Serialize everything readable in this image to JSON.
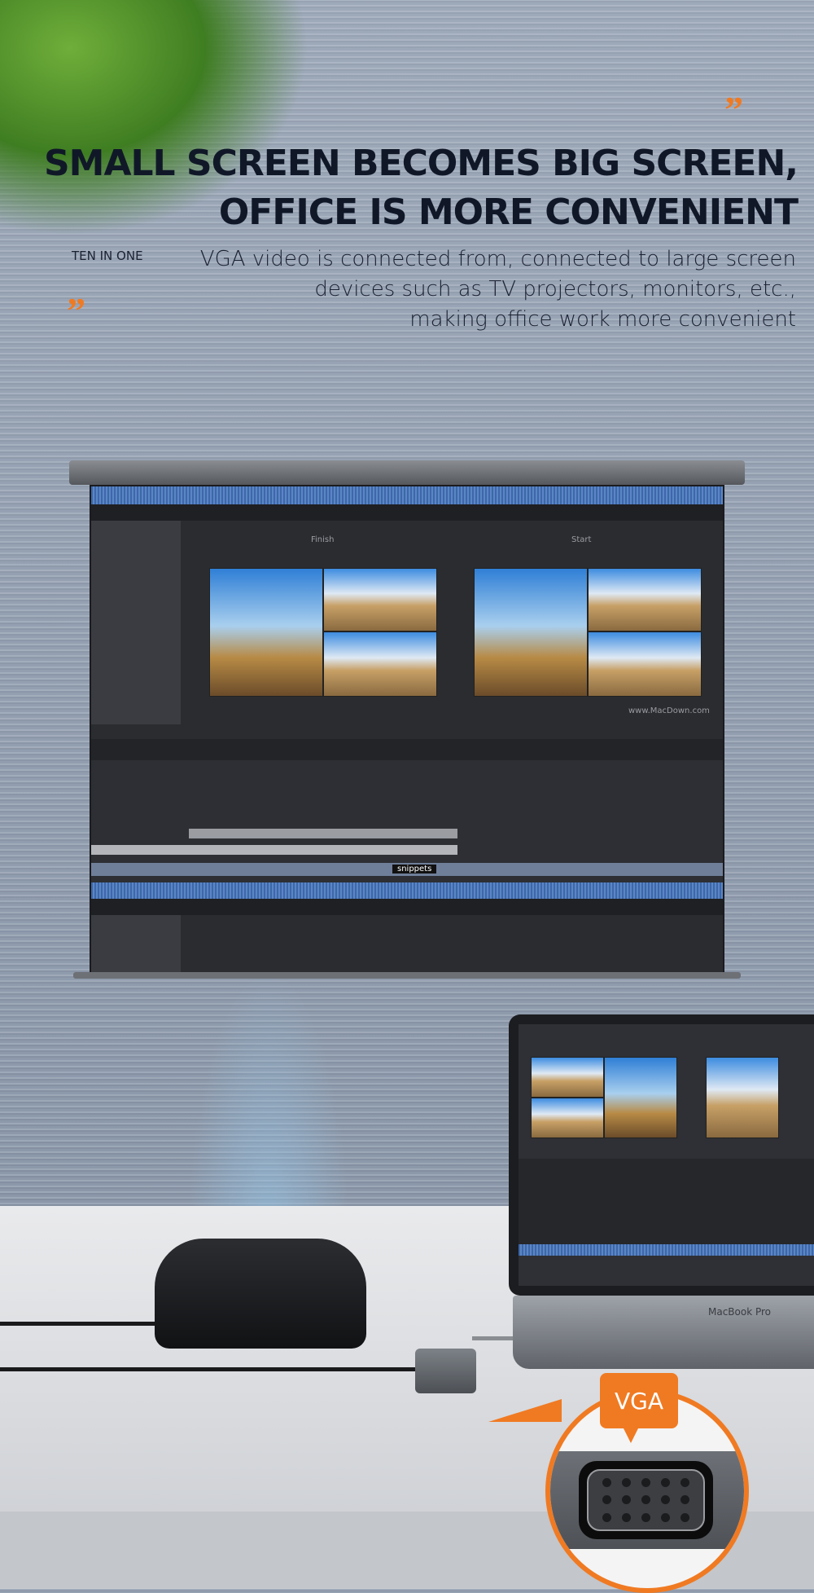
{
  "headline": {
    "line1": "SMALL SCREEN BECOMES BIG SCREEN,",
    "line2": "OFFICE IS MORE CONVENIENT"
  },
  "tag": "TEN IN ONE",
  "description": {
    "line1": "VGA video is connected from, connected to large screen",
    "line2": "devices such as TV projectors, monitors, etc.,",
    "line3": "making office work more convenient"
  },
  "quote_mark": "”",
  "projector_screen": {
    "left_label": "Finish",
    "right_label": "Start",
    "website": "www.MacDown.com",
    "track_label": "snippets"
  },
  "laptop": {
    "model": "MacBook Pro"
  },
  "callout": {
    "label": "VGA",
    "pin_rows": [
      5,
      5,
      5
    ]
  },
  "colors": {
    "accent": "#f07a22",
    "headline": "#101828"
  }
}
